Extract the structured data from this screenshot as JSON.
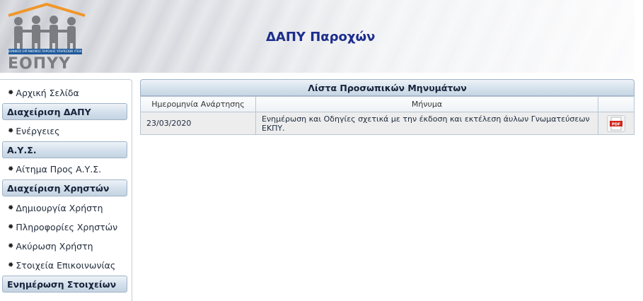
{
  "header": {
    "title": "ΔΑΠΥ Παροχών",
    "logo_text": "ΕΟΠΥΥ",
    "logo_subtitle": "ΕΘΝΙΚΟΣ ΟΡΓΑΝΙΣΜΟΣ ΠΑΡΟΧΗΣ ΥΠΗΡΕΣΙΩΝ ΥΓΕΙΑΣ"
  },
  "sidebar": {
    "home": "Αρχική Σελίδα",
    "section_dapy": "Διαχείριση ΔΑΠΥ",
    "actions": "Ενέργειες",
    "section_ays": "Α.Υ.Σ.",
    "request_ays": "Αίτημα Προς Α.Υ.Σ.",
    "section_users": "Διαχείριση Χρηστών",
    "create_user": "Δημιουργία Χρήστη",
    "user_info": "Πληροφορίες Χρηστών",
    "cancel_user": "Ακύρωση Χρήστη",
    "contact_info": "Στοιχεία Επικοινωνίας",
    "section_update": "Ενημέρωση Στοιχείων"
  },
  "messages": {
    "title": "Λίστα Προσωπικών Μηνυμάτων",
    "col_date": "Ημερομηνία Ανάρτησης",
    "col_message": "Μήνυμα",
    "rows": [
      {
        "date": "23/03/2020",
        "message": "Ενημέρωση και Οδηγίες σχετικά με την έκδοση και εκτέλεση άυλων Γνωματεύσεων ΕΚΠΥ.",
        "attachment": "pdf-icon"
      }
    ]
  },
  "colors": {
    "title": "#1c2e8c",
    "logo_blue": "#1f5a9c",
    "logo_orange": "#f0962a",
    "pdf_red": "#d0261b"
  }
}
